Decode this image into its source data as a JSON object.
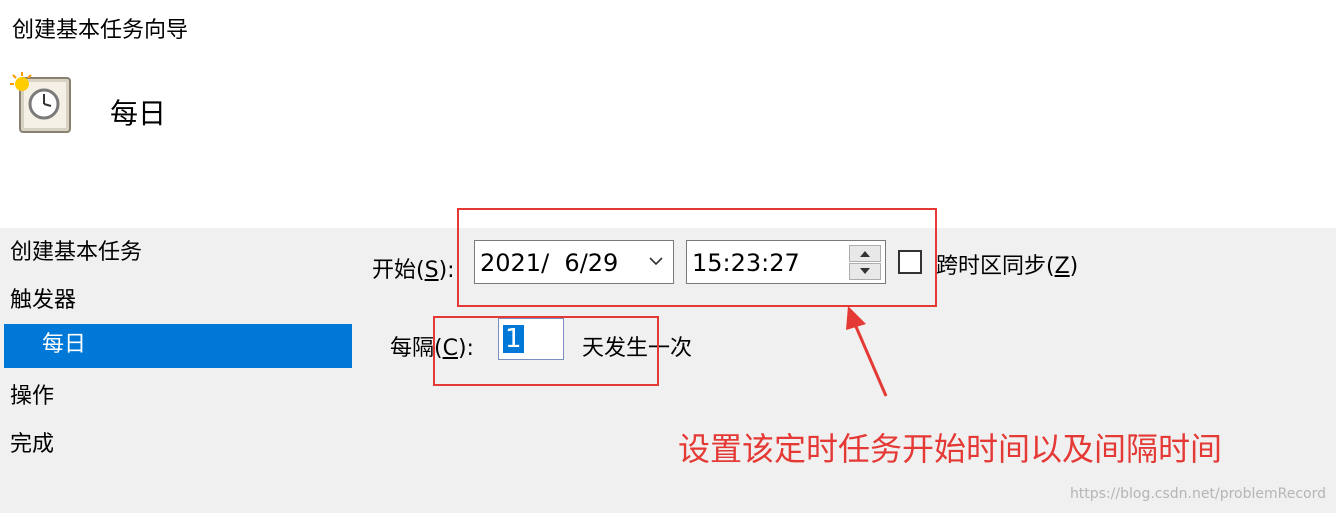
{
  "window": {
    "title": "创建基本任务向导"
  },
  "header": {
    "title": "每日",
    "icon": "calendar-clock-icon"
  },
  "nav": {
    "items": [
      {
        "label": "创建基本任务"
      },
      {
        "label": "触发器"
      },
      {
        "label": "每日"
      },
      {
        "label": "操作"
      },
      {
        "label": "完成"
      }
    ]
  },
  "form": {
    "start_label_prefix": "开始(",
    "start_label_key": "S",
    "start_label_suffix": "):",
    "date_value": "2021/  6/29",
    "time_value": "15:23:27",
    "sync_label_prefix": "跨时区同步(",
    "sync_label_key": "Z",
    "sync_label_suffix": ")",
    "sync_checked": false,
    "interval_label_prefix": "每隔(",
    "interval_label_key": "C",
    "interval_label_suffix": "):",
    "interval_value": "1",
    "interval_unit": "天发生一次"
  },
  "annotation": {
    "text": "设置该定时任务开始时间以及间隔时间"
  },
  "watermark": {
    "text": "https://blog.csdn.net/problemRecord"
  },
  "colors": {
    "accent": "#0078d7",
    "annotation": "#e53935",
    "panel": "#f0f0f0"
  }
}
